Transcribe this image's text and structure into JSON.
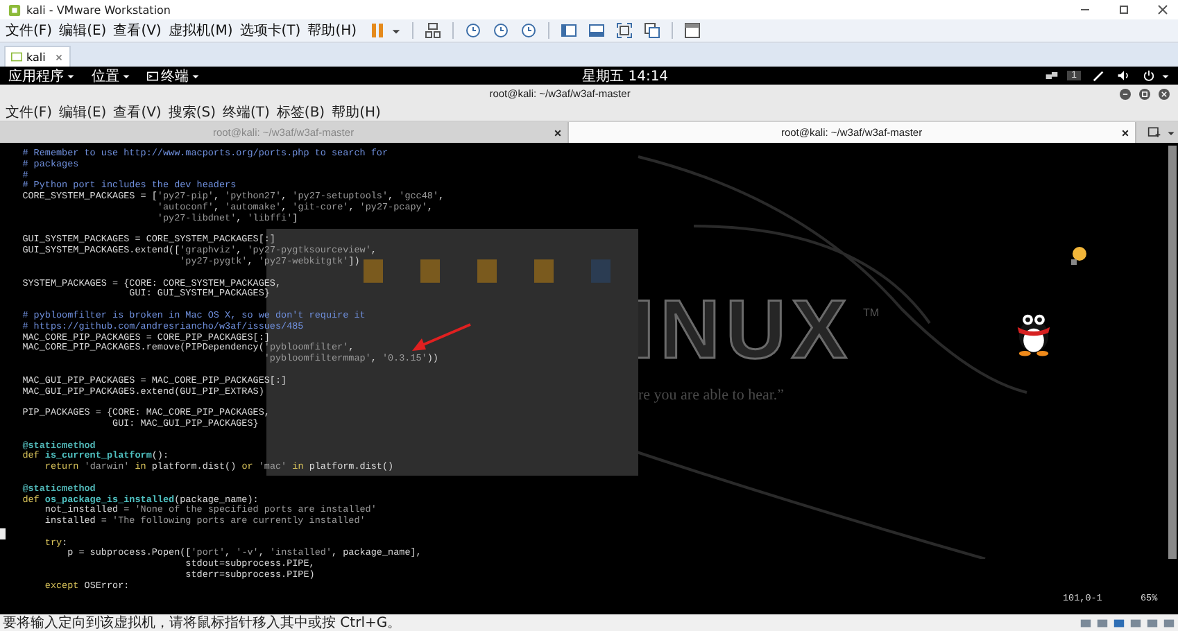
{
  "window": {
    "title": "kali - VMware Workstation"
  },
  "menu": [
    "文件(F)",
    "编辑(E)",
    "查看(V)",
    "虚拟机(M)",
    "选项卡(T)",
    "帮助(H)"
  ],
  "vm_tabs": [
    {
      "label": "kali",
      "selected": true
    }
  ],
  "top_bar": {
    "menus": [
      "应用程序",
      "位置",
      "终端"
    ],
    "clock": "星期五 14:14",
    "workspace": "1"
  },
  "terminal": {
    "title": "root@kali: ~/w3af/w3af-master",
    "menu": [
      "文件(F)",
      "编辑(E)",
      "查看(V)",
      "搜索(S)",
      "终端(T)",
      "标签(B)",
      "帮助(H)"
    ],
    "tabs": [
      {
        "label": "root@kali: ~/w3af/w3af-master",
        "selected": false
      },
      {
        "label": "root@kali: ~/w3af/w3af-master",
        "selected": true
      }
    ],
    "lines": [
      {
        "cursor": false,
        "segments": [
          {
            "kind": "comment",
            "text": "    # Remember to use http://www.macports.org/ports.php to search for"
          }
        ]
      },
      {
        "cursor": false,
        "segments": [
          {
            "kind": "comment",
            "text": "    # packages"
          }
        ]
      },
      {
        "cursor": false,
        "segments": [
          {
            "kind": "comment",
            "text": "    #"
          }
        ]
      },
      {
        "cursor": false,
        "segments": [
          {
            "kind": "comment",
            "text": "    # Python port includes the dev headers"
          }
        ]
      },
      {
        "cursor": false,
        "segments": [
          {
            "kind": "plain",
            "text": "    CORE_SYSTEM_PACKAGES = ["
          },
          {
            "kind": "string",
            "text": "'py27-pip'"
          },
          {
            "kind": "plain",
            "text": ", "
          },
          {
            "kind": "string",
            "text": "'python27'"
          },
          {
            "kind": "plain",
            "text": ", "
          },
          {
            "kind": "string",
            "text": "'py27-setuptools'"
          },
          {
            "kind": "plain",
            "text": ", "
          },
          {
            "kind": "string",
            "text": "'gcc48'"
          },
          {
            "kind": "plain",
            "text": ","
          }
        ]
      },
      {
        "cursor": false,
        "segments": [
          {
            "kind": "string",
            "text": "                            'autoconf'"
          },
          {
            "kind": "plain",
            "text": ", "
          },
          {
            "kind": "string",
            "text": "'automake'"
          },
          {
            "kind": "plain",
            "text": ", "
          },
          {
            "kind": "string",
            "text": "'git-core'"
          },
          {
            "kind": "plain",
            "text": ", "
          },
          {
            "kind": "string",
            "text": "'py27-pcapy'"
          },
          {
            "kind": "plain",
            "text": ","
          }
        ]
      },
      {
        "cursor": false,
        "segments": [
          {
            "kind": "string",
            "text": "                            'py27-libdnet'"
          },
          {
            "kind": "plain",
            "text": ", "
          },
          {
            "kind": "string",
            "text": "'libffi'"
          },
          {
            "kind": "plain",
            "text": "]"
          }
        ]
      },
      {
        "cursor": false
      },
      {
        "cursor": false,
        "segments": [
          {
            "kind": "plain",
            "text": "    GUI_SYSTEM_PACKAGES = CORE_SYSTEM_PACKAGES[:]"
          }
        ]
      },
      {
        "cursor": false,
        "segments": [
          {
            "kind": "plain",
            "text": "    GUI_SYSTEM_PACKAGES.extend(["
          },
          {
            "kind": "string",
            "text": "'graphviz'"
          },
          {
            "kind": "plain",
            "text": ", "
          },
          {
            "kind": "string",
            "text": "'py27-pygtksourceview'"
          },
          {
            "kind": "plain",
            "text": ","
          }
        ]
      },
      {
        "cursor": false,
        "segments": [
          {
            "kind": "string",
            "text": "                                'py27-pygtk'"
          },
          {
            "kind": "plain",
            "text": ", "
          },
          {
            "kind": "string",
            "text": "'py27-webkitgtk'"
          },
          {
            "kind": "plain",
            "text": "])"
          }
        ]
      },
      {
        "cursor": false
      },
      {
        "cursor": false,
        "segments": [
          {
            "kind": "plain",
            "text": "    SYSTEM_PACKAGES = {CORE: CORE_SYSTEM_PACKAGES,"
          }
        ]
      },
      {
        "cursor": false,
        "segments": [
          {
            "kind": "plain",
            "text": "                       GUI: GUI_SYSTEM_PACKAGES}"
          }
        ]
      },
      {
        "cursor": false
      },
      {
        "cursor": false,
        "segments": [
          {
            "kind": "comment",
            "text": "    # pybloomfilter is broken in Mac OS X, so we don't require it"
          }
        ]
      },
      {
        "cursor": false,
        "segments": [
          {
            "kind": "comment",
            "text": "    # https://github.com/andresriancho/w3af/issues/485"
          }
        ]
      },
      {
        "cursor": false,
        "segments": [
          {
            "kind": "plain",
            "text": "    MAC_CORE_PIP_PACKAGES = CORE_PIP_PACKAGES[:]"
          }
        ]
      },
      {
        "cursor": false,
        "segments": [
          {
            "kind": "plain",
            "text": "    MAC_CORE_PIP_PACKAGES.remove(PIPDependency("
          },
          {
            "kind": "string",
            "text": "'pybloomfilter'"
          },
          {
            "kind": "plain",
            "text": ","
          }
        ]
      },
      {
        "cursor": false,
        "segments": [
          {
            "kind": "string",
            "text": "                                               'pybloomfiltermmap'"
          },
          {
            "kind": "plain",
            "text": ", "
          },
          {
            "kind": "string",
            "text": "'0.3.15'"
          },
          {
            "kind": "plain",
            "text": "))"
          }
        ]
      },
      {
        "cursor": false
      },
      {
        "cursor": false,
        "segments": [
          {
            "kind": "plain",
            "text": "    MAC_GUI_PIP_PACKAGES = MAC_CORE_PIP_PACKAGES[:]"
          }
        ]
      },
      {
        "cursor": false,
        "segments": [
          {
            "kind": "plain",
            "text": "    MAC_GUI_PIP_PACKAGES.extend(GUI_PIP_EXTRAS)"
          }
        ]
      },
      {
        "cursor": false
      },
      {
        "cursor": false,
        "segments": [
          {
            "kind": "plain",
            "text": "    PIP_PACKAGES = {CORE: MAC_CORE_PIP_PACKAGES,"
          }
        ]
      },
      {
        "cursor": false,
        "segments": [
          {
            "kind": "plain",
            "text": "                    GUI: MAC_GUI_PIP_PACKAGES}"
          }
        ]
      },
      {
        "cursor": false
      },
      {
        "cursor": false,
        "segments": [
          {
            "kind": "decorator",
            "text": "    @staticmethod"
          }
        ]
      },
      {
        "cursor": false,
        "segments": [
          {
            "kind": "keyword",
            "text": "    def "
          },
          {
            "kind": "function",
            "text": "is_current_platform"
          },
          {
            "kind": "plain",
            "text": "():"
          }
        ]
      },
      {
        "cursor": false,
        "segments": [
          {
            "kind": "keyword",
            "text": "        return "
          },
          {
            "kind": "string",
            "text": "'darwin'"
          },
          {
            "kind": "keyword",
            "text": " in "
          },
          {
            "kind": "plain",
            "text": "platform.dist() "
          },
          {
            "kind": "keyword",
            "text": "or "
          },
          {
            "kind": "string",
            "text": "'mac'"
          },
          {
            "kind": "keyword",
            "text": " in "
          },
          {
            "kind": "plain",
            "text": "platform.dist()"
          }
        ]
      },
      {
        "cursor": false
      },
      {
        "cursor": false,
        "segments": [
          {
            "kind": "decorator",
            "text": "    @staticmethod"
          }
        ]
      },
      {
        "cursor": false,
        "segments": [
          {
            "kind": "keyword",
            "text": "    def "
          },
          {
            "kind": "function",
            "text": "os_package_is_installed"
          },
          {
            "kind": "plain",
            "text": "(package_name):"
          }
        ]
      },
      {
        "cursor": false,
        "segments": [
          {
            "kind": "plain",
            "text": "        not_installed = "
          },
          {
            "kind": "string",
            "text": "'None of the specified ports are installed'"
          }
        ]
      },
      {
        "cursor": false,
        "segments": [
          {
            "kind": "plain",
            "text": "        installed = "
          },
          {
            "kind": "string",
            "text": "'The following ports are currently installed'"
          }
        ]
      },
      {
        "cursor": true
      },
      {
        "cursor": false,
        "segments": [
          {
            "kind": "keyword",
            "text": "        try"
          },
          {
            "kind": "plain",
            "text": ":"
          }
        ]
      },
      {
        "cursor": false,
        "segments": [
          {
            "kind": "plain",
            "text": "            p = subprocess.Popen(["
          },
          {
            "kind": "string",
            "text": "'port'"
          },
          {
            "kind": "plain",
            "text": ", "
          },
          {
            "kind": "string",
            "text": "'-v'"
          },
          {
            "kind": "plain",
            "text": ", "
          },
          {
            "kind": "string",
            "text": "'installed'"
          },
          {
            "kind": "plain",
            "text": ", package_name],"
          }
        ]
      },
      {
        "cursor": false,
        "segments": [
          {
            "kind": "plain",
            "text": "                                 stdout=subprocess.PIPE,"
          }
        ]
      },
      {
        "cursor": false,
        "segments": [
          {
            "kind": "plain",
            "text": "                                 stderr=subprocess.PIPE)"
          }
        ]
      },
      {
        "cursor": false,
        "segments": [
          {
            "kind": "keyword",
            "text": "        except "
          },
          {
            "kind": "plain",
            "text": "OSError:"
          }
        ]
      }
    ],
    "position": "101,0-1",
    "percent": "65%"
  },
  "wallpaper": {
    "logo": "INUX",
    "trademark": "TM",
    "slogan": "re you are able to hear.”"
  },
  "status_bar": {
    "message": "要将输入定向到该虚拟机，请将鼠标指针移入其中或按 Ctrl+G。"
  }
}
